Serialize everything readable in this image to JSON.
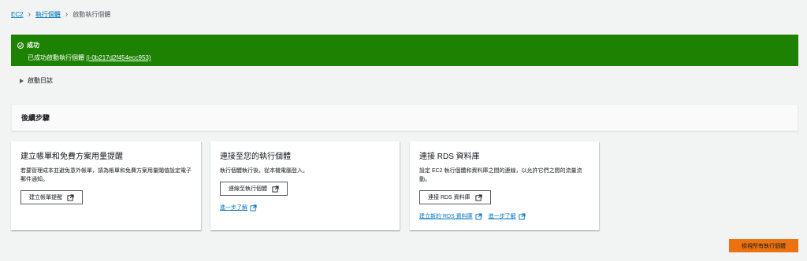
{
  "breadcrumb": {
    "items": [
      "EC2",
      "執行個體"
    ],
    "current": "啟動執行個體"
  },
  "flash": {
    "title": "成功",
    "message": "已成功啟動執行個體",
    "instance_link": "(i-0b217d2f454ecc953)",
    "color": "#1d8102"
  },
  "expander": {
    "label": "啟動日誌"
  },
  "next_steps": {
    "heading": "後續步驟"
  },
  "cards": [
    {
      "title": "建立帳單和免費方案用量提醒",
      "description": "若要管理成本並避免意外帳單，請為帳單和免費方案用量閾值設定電子郵件通知。",
      "button": "建立帳單提醒"
    },
    {
      "title": "連接至您的執行個體",
      "description": "執行個體執行後，從本機電腦登入。",
      "button": "連線至執行個體",
      "link": "進一步了解"
    },
    {
      "title": "連接 RDS 資料庫",
      "description": "設定 EC2 執行個體和資料庫之間的連線，以允許它們之間的流量流動。",
      "button": "連接 RDS 資料庫",
      "links": [
        "建立新的 RDS 資料庫",
        "進一步了解"
      ]
    }
  ],
  "footer": {
    "primary_button": "檢視所有執行個體",
    "accent": "#ec7211"
  }
}
